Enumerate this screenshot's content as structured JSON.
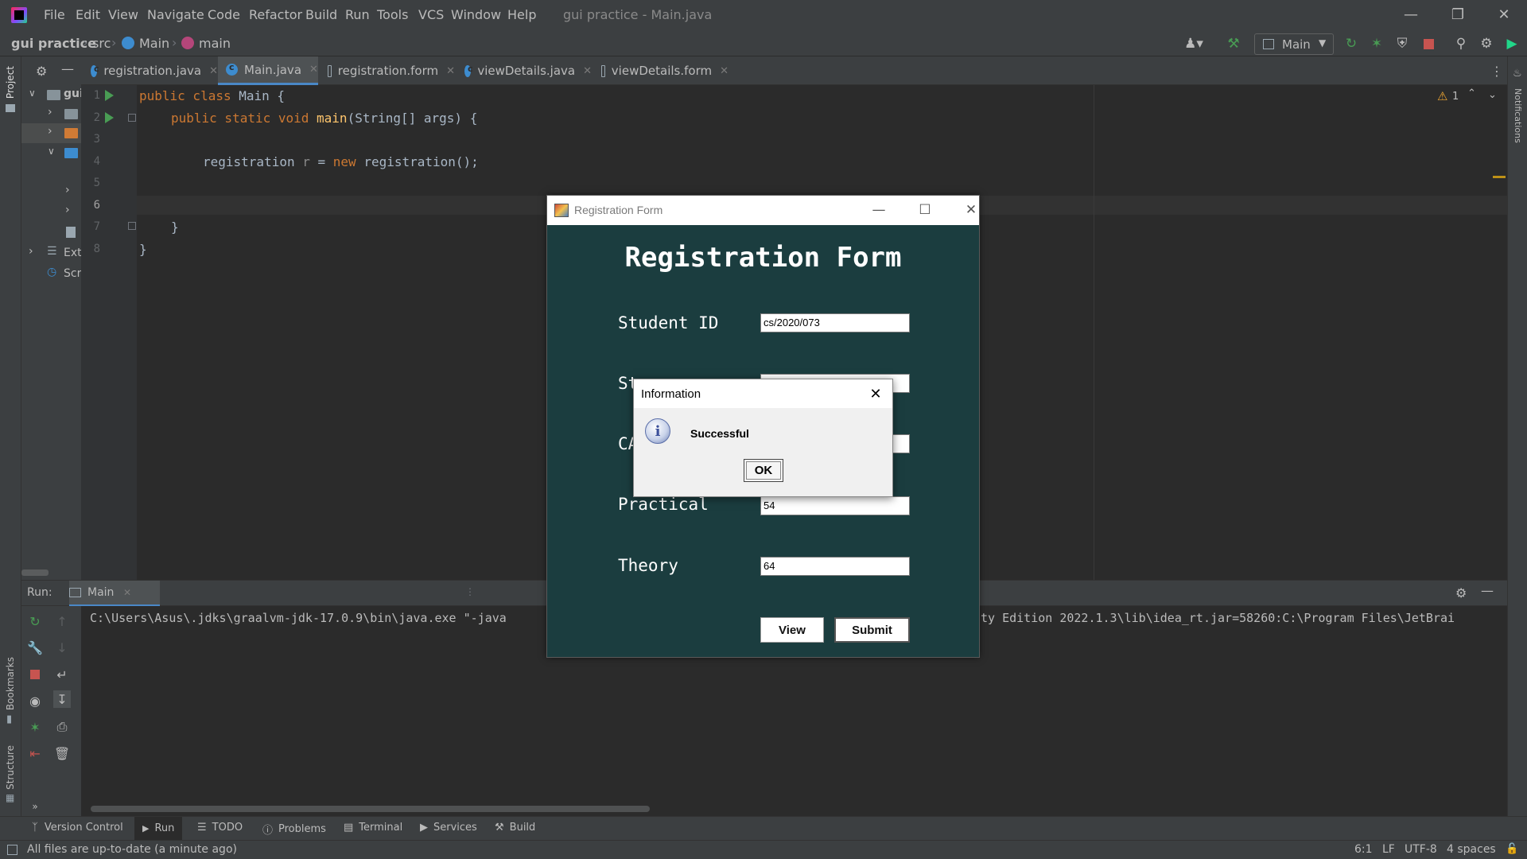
{
  "menu": [
    "File",
    "Edit",
    "View",
    "Navigate",
    "Code",
    "Refactor",
    "Build",
    "Run",
    "Tools",
    "VCS",
    "Window",
    "Help"
  ],
  "window_title": "gui practice - Main.java",
  "breadcrumb": {
    "project": "gui practice",
    "src": "src",
    "cls": "Main",
    "method": "main"
  },
  "run_config": "Main",
  "tabs": [
    {
      "label": "registration.java"
    },
    {
      "label": "Main.java"
    },
    {
      "label": "registration.form"
    },
    {
      "label": "viewDetails.java"
    },
    {
      "label": "viewDetails.form"
    }
  ],
  "tree": {
    "root": "gui",
    "ext": "Ext",
    "scr": "Scr"
  },
  "side_labels": {
    "project": "Project",
    "bookmarks": "Bookmarks",
    "structure": "Structure",
    "notifications": "Notifications"
  },
  "warnings": "1",
  "code": {
    "line1": [
      "public class ",
      "Main",
      " {"
    ],
    "line2": [
      "public static void ",
      "main",
      "(String[] args) {"
    ],
    "line4": [
      "registration ",
      "r",
      " = ",
      "new ",
      "registration();"
    ],
    "line7": "}",
    "line8": "}"
  },
  "line_numbers": [
    "1",
    "2",
    "3",
    "4",
    "5",
    "6",
    "7",
    "8"
  ],
  "run_panel": {
    "label": "Run:",
    "tab": "Main",
    "console_left": "C:\\Users\\Asus\\.jdks\\graalvm-jdk-17.0.9\\bin\\java.exe \"-java",
    "console_right": "ty Edition 2022.1.3\\lib\\idea_rt.jar=58260:C:\\Program Files\\JetBrai"
  },
  "bottom_tabs": [
    "Version Control",
    "Run",
    "TODO",
    "Problems",
    "Terminal",
    "Services",
    "Build"
  ],
  "status": {
    "message": "All files are up-to-date (a minute ago)",
    "position": "6:1",
    "line_sep": "LF",
    "encoding": "UTF-8",
    "indent": "4 spaces"
  },
  "reg_form": {
    "window_title": "Registration Form",
    "heading": "Registration Form",
    "fields": [
      {
        "label": "Student ID",
        "value": "cs/2020/073"
      },
      {
        "label": "St",
        "value": ""
      },
      {
        "label": "CA",
        "value": ""
      },
      {
        "label": "Practical",
        "value": "54"
      },
      {
        "label": "Theory",
        "value": "64"
      }
    ],
    "view_btn": "View",
    "submit_btn": "Submit"
  },
  "dialog": {
    "title": "Information",
    "message": "Successful",
    "ok": "OK"
  },
  "colors": {
    "editor_bg": "#2b2b2b",
    "chrome_bg": "#3c3f41",
    "form_bg": "#1b3d3f",
    "keyword": "#cc7832",
    "method": "#ffc66d"
  }
}
